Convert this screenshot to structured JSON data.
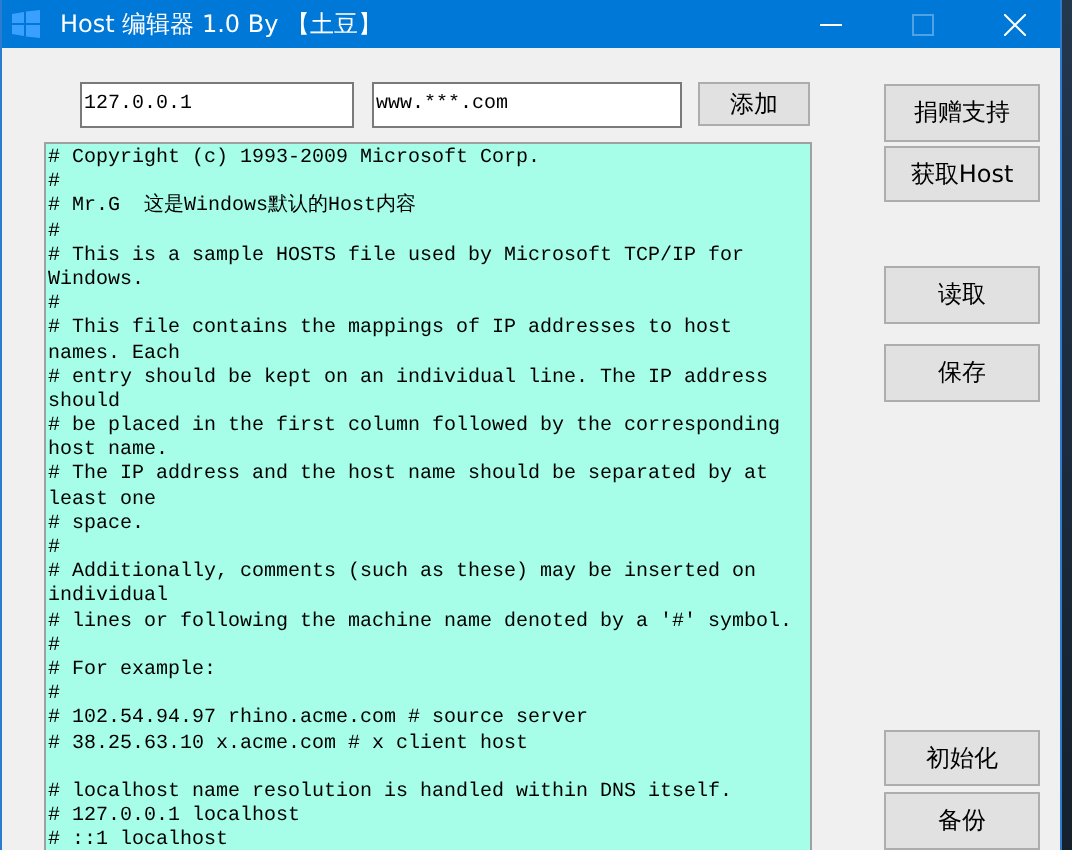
{
  "window": {
    "title": "Host 编辑器 1.0 By 【土豆】",
    "controls": [
      {
        "kind": "minimize",
        "disabled": false
      },
      {
        "kind": "maximize",
        "disabled": true
      },
      {
        "kind": "close",
        "disabled": false
      }
    ]
  },
  "ip_field": {
    "value": "127.0.0.1"
  },
  "host_field": {
    "value": "www.***.com"
  },
  "add_button": "添加",
  "editor": {
    "sections": [
      [
        "# Copyright (c) 1993-2009 Microsoft Corp.",
        "#",
        "# Mr.G  这是Windows默认的Host内容",
        "#",
        "# This is a sample HOSTS file used by Microsoft TCP/IP for",
        "Windows.",
        "#",
        "# This file contains the mappings of IP addresses to host",
        "names. Each",
        "# entry should be kept on an individual line. The IP address",
        "should",
        "# be placed in the first column followed by the corresponding",
        "host name.",
        "# The IP address and the host name should be separated by at",
        "least one",
        "# space.",
        "#",
        "# Additionally, comments (such as these) may be inserted on",
        "individual",
        "# lines or following the machine name denoted by a '#' symbol.",
        "#",
        "# For example:",
        "#",
        "# 102.54.94.97 rhino.acme.com # source server",
        "# 38.25.63.10 x.acme.com # x client host"
      ],
      [
        "# localhost name resolution is handled within DNS itself.",
        "# 127.0.0.1 localhost",
        "# ::1 localhost"
      ]
    ]
  },
  "side_buttons": [
    {
      "label": "捐赠支持",
      "kind": "top"
    },
    {
      "label": "获取Host",
      "kind": "top"
    },
    {
      "label": "读取",
      "kind": "middle"
    },
    {
      "label": "保存",
      "kind": "middle"
    },
    {
      "label": "初始化",
      "kind": "bottom"
    },
    {
      "label": "备份",
      "kind": "bottom"
    }
  ]
}
